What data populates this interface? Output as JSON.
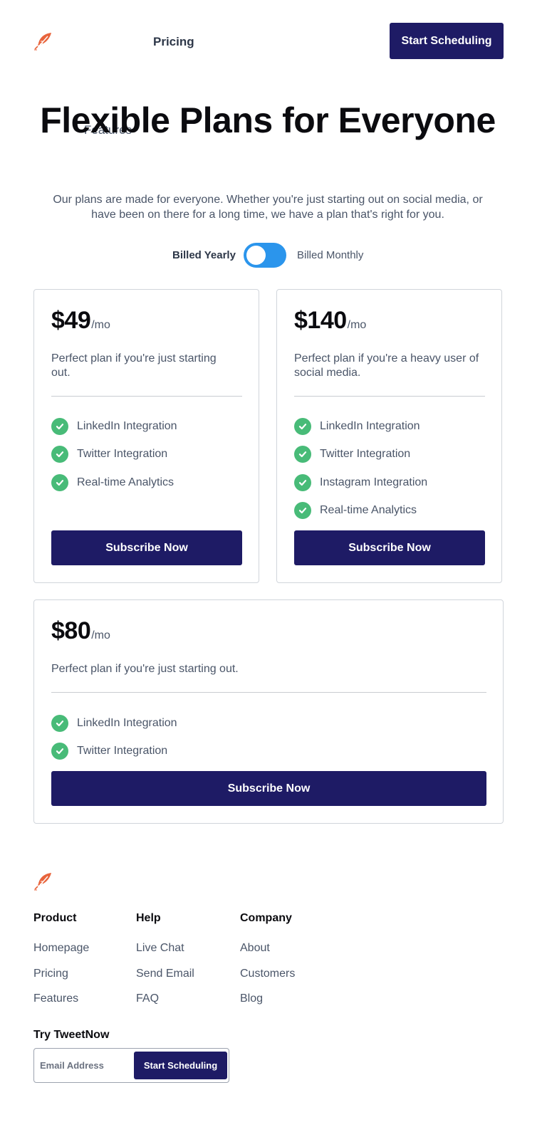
{
  "nav": {
    "logo_icon": "feather-icon",
    "links": [
      "Features",
      "Pricing"
    ],
    "cta": "Start Scheduling"
  },
  "hero": {
    "title": "Flexible Plans for Everyone",
    "subtitle": "Our plans are made for everyone. Whether you're just starting out on social media, or have been on there for a long time, we have a plan that's right for you."
  },
  "billing": {
    "yearly": "Billed Yearly",
    "monthly": "Billed Monthly",
    "toggle_state": "monthly"
  },
  "plans": [
    {
      "price": "$49",
      "unit": "/mo",
      "description": "Perfect plan if you're just starting out.",
      "features": [
        "LinkedIn Integration",
        "Twitter Integration",
        "Real-time Analytics"
      ],
      "button": "Subscribe Now"
    },
    {
      "price": "$140",
      "unit": "/mo",
      "description": "Perfect plan if you're a heavy user of social media.",
      "features": [
        "LinkedIn Integration",
        "Twitter Integration",
        "Instagram Integration",
        "Real-time Analytics"
      ],
      "button": "Subscribe Now"
    },
    {
      "price": "$80",
      "unit": "/mo",
      "description": "Perfect plan if you're just starting out.",
      "features": [
        "LinkedIn Integration",
        "Twitter Integration"
      ],
      "button": "Subscribe Now"
    }
  ],
  "footer": {
    "columns": [
      {
        "heading": "Product",
        "links": [
          "Homepage",
          "Pricing",
          "Features"
        ]
      },
      {
        "heading": "Help",
        "links": [
          "Live Chat",
          "Send Email",
          "FAQ"
        ]
      },
      {
        "heading": "Company",
        "links": [
          "About",
          "Customers",
          "Blog"
        ]
      }
    ],
    "try_heading": "Try TweetNow",
    "email_placeholder": "Email Address",
    "cta": "Start Scheduling"
  },
  "colors": {
    "brand": "#1e1b65",
    "toggle": "#2b95ec",
    "check": "#48bb78",
    "logo": "#e8643c"
  }
}
